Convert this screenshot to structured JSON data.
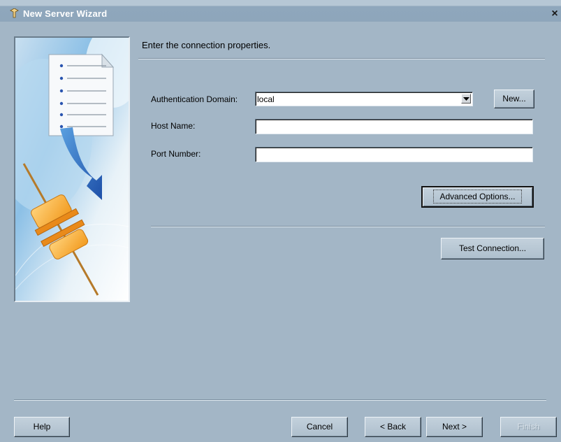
{
  "window": {
    "title": "New Server Wizard",
    "close_glyph": "×",
    "icon": "wizard-icon"
  },
  "banner": {
    "image": "document-to-connector-illustration"
  },
  "page": {
    "heading": "Enter the connection properties."
  },
  "form": {
    "auth_domain": {
      "label": "Authentication Domain:",
      "value": "local",
      "new_button": "New..."
    },
    "host_name": {
      "label": "Host Name:",
      "value": ""
    },
    "port_number": {
      "label": "Port Number:",
      "value": ""
    },
    "advanced_options_button": "Advanced Options...",
    "test_connection_button": "Test Connection..."
  },
  "footer": {
    "help": "Help",
    "cancel": "Cancel",
    "back": "< Back",
    "next": "Next >",
    "finish": "Finish"
  }
}
